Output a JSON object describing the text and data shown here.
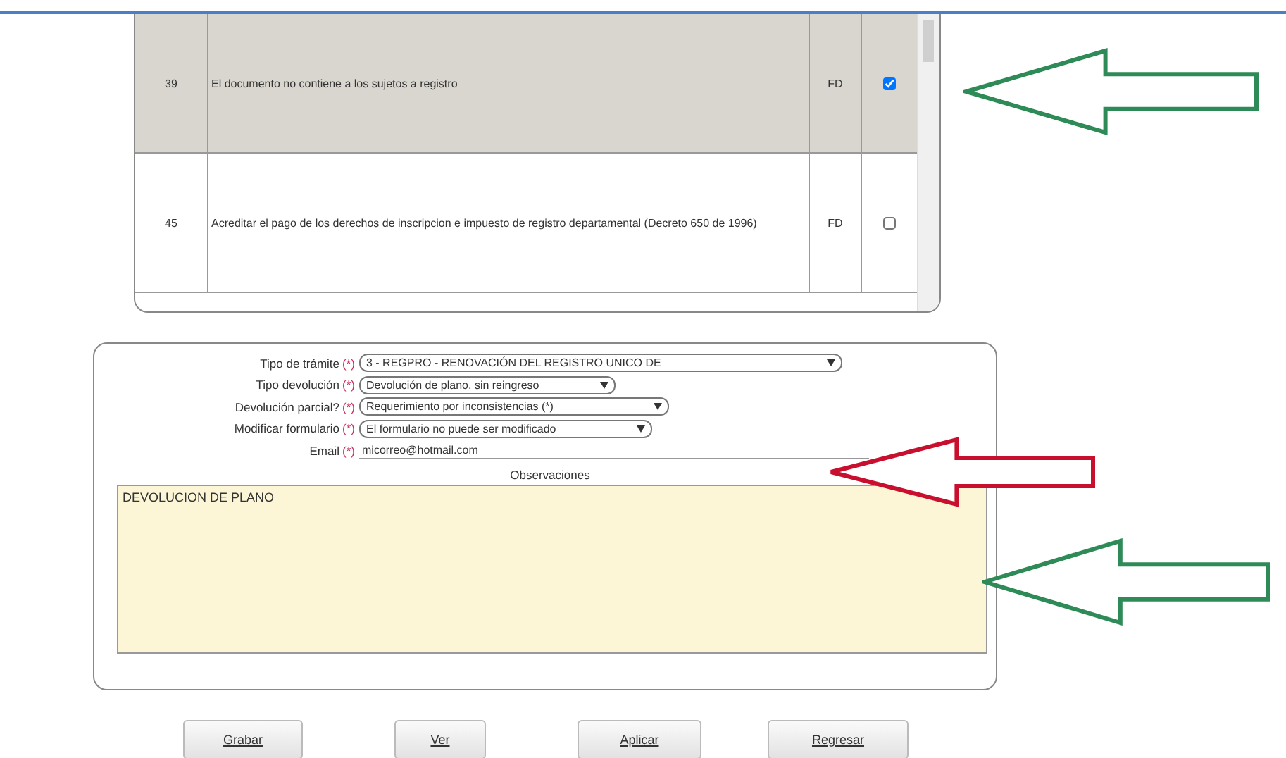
{
  "requirements_table": {
    "rows": [
      {
        "number": "39",
        "description": "El documento no contiene a los sujetos a registro",
        "code": "FD",
        "checked": true,
        "selected": true
      },
      {
        "number": "45",
        "description": "Acreditar el pago de los derechos de inscripcion e impuesto de registro departamental (Decreto 650 de 1996)",
        "code": "FD",
        "checked": false,
        "selected": false
      }
    ]
  },
  "form": {
    "fields": [
      {
        "kind": "select",
        "label": "Tipo de trámite",
        "required_mark": "(*)",
        "value": "3 - REGPRO - RENOVACIÓN DEL REGISTRO UNICO DE"
      },
      {
        "kind": "select",
        "label": "Tipo devolución",
        "required_mark": "(*)",
        "value": "Devolución de plano, sin reingreso"
      },
      {
        "kind": "select",
        "label": "Devolución parcial?",
        "required_mark": "(*)",
        "value": "Requerimiento por inconsistencias (*)"
      },
      {
        "kind": "select",
        "label": "Modificar formulario",
        "required_mark": "(*)",
        "value": "El formulario no puede ser modificado"
      },
      {
        "kind": "input",
        "label": "Email",
        "required_mark": "(*)",
        "value": "micorreo@hotmail.com"
      }
    ],
    "observations": {
      "label": "Observaciones",
      "value": "DEVOLUCION DE PLANO"
    }
  },
  "buttons": [
    "Grabar",
    "Ver",
    "Aplicar",
    "Regresar"
  ],
  "annotations": [
    {
      "kind": "arrow",
      "color": "#2e8b57"
    },
    {
      "kind": "arrow",
      "color": "#c8102e"
    },
    {
      "kind": "arrow",
      "color": "#2e8b57"
    }
  ]
}
